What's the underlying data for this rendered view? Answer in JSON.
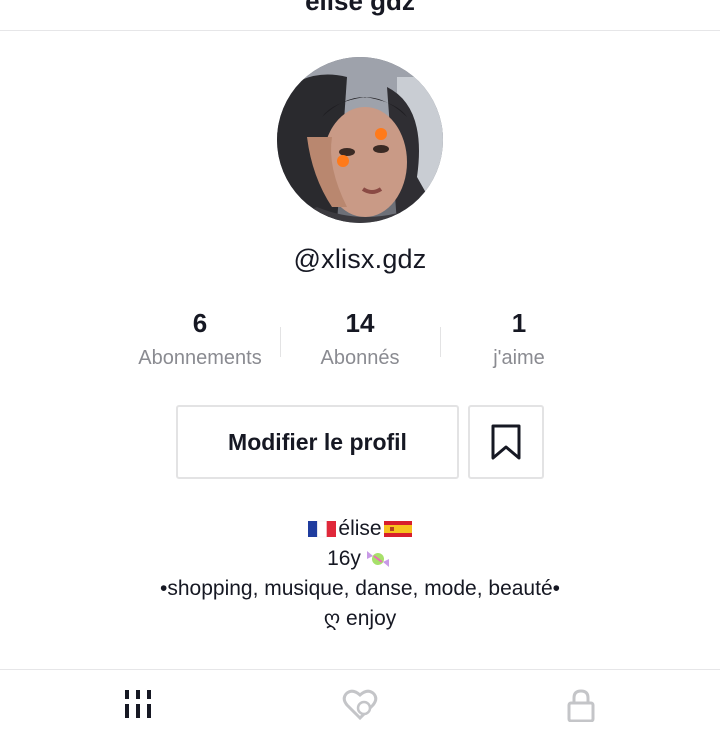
{
  "header": {
    "title": "élise gdz",
    "add_user_icon": "add-user-icon"
  },
  "profile": {
    "username": "@xlisx.gdz",
    "avatar_icon": "profile-photo"
  },
  "stats": [
    {
      "value": "6",
      "label": "Abonnements"
    },
    {
      "value": "14",
      "label": "Abonnés"
    },
    {
      "value": "1",
      "label": "j'aime"
    }
  ],
  "actions": {
    "edit_label": "Modifier le profil",
    "bookmark_icon": "bookmark-icon"
  },
  "bio": {
    "line1_name": "élise",
    "line2_age": "16y",
    "line3": "•shopping, musique, danse, mode, beauté•",
    "line4": "ღ enjoy"
  },
  "tabs": [
    {
      "icon": "grid-icon",
      "active": true
    },
    {
      "icon": "liked-hidden-icon",
      "active": false
    },
    {
      "icon": "lock-icon",
      "active": false
    }
  ],
  "colors": {
    "text": "#161823",
    "muted": "#8a8b91",
    "border": "#e3e3e4"
  }
}
